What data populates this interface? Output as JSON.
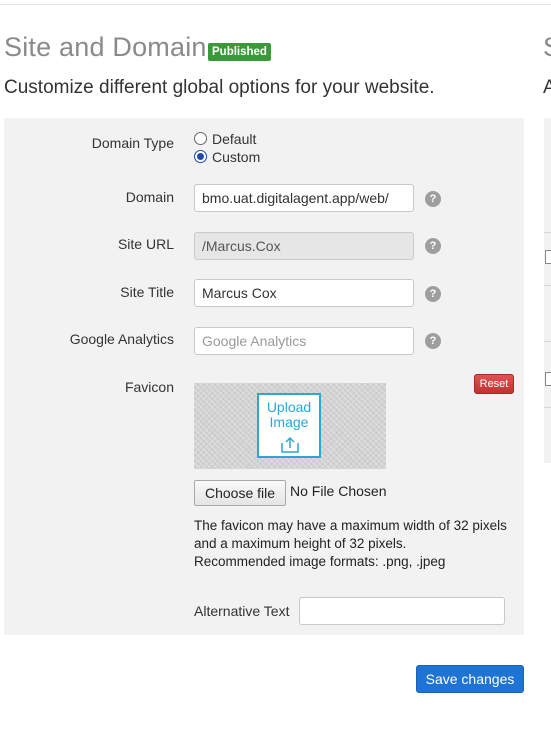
{
  "header": {
    "title": "Site and Domain",
    "status_badge": "Published",
    "subtitle": "Customize different global options for your website."
  },
  "form": {
    "domain_type": {
      "label": "Domain Type",
      "options": [
        {
          "label": "Default",
          "selected": false
        },
        {
          "label": "Custom",
          "selected": true
        }
      ]
    },
    "domain": {
      "label": "Domain",
      "value": "bmo.uat.digitalagent.app/web/"
    },
    "site_url": {
      "label": "Site URL",
      "value": "/Marcus.Cox"
    },
    "site_title": {
      "label": "Site Title",
      "value": "Marcus Cox"
    },
    "google_analytics": {
      "label": "Google Analytics",
      "value": "",
      "placeholder": "Google Analytics"
    },
    "favicon": {
      "label": "Favicon",
      "upload_text": "Upload Image",
      "reset_label": "Reset",
      "choose_file_label": "Choose file",
      "file_status": "No File Chosen",
      "note_lines": [
        "The favicon may have a maximum width of 32 pixels",
        "and a maximum height of 32 pixels.",
        "Recommended image formats: .png, .jpeg"
      ]
    },
    "alt_text": {
      "label": "Alternative Text",
      "value": ""
    },
    "help_glyph": "?"
  },
  "actions": {
    "save_label": "Save changes"
  },
  "next_card": {
    "title_fragment": "S",
    "subtitle_fragment": "A"
  },
  "colors": {
    "badge_green": "#3a9a3a",
    "save_blue": "#1e73d4",
    "reset_red": "#c23232",
    "upload_accent": "#2aa7d6"
  }
}
